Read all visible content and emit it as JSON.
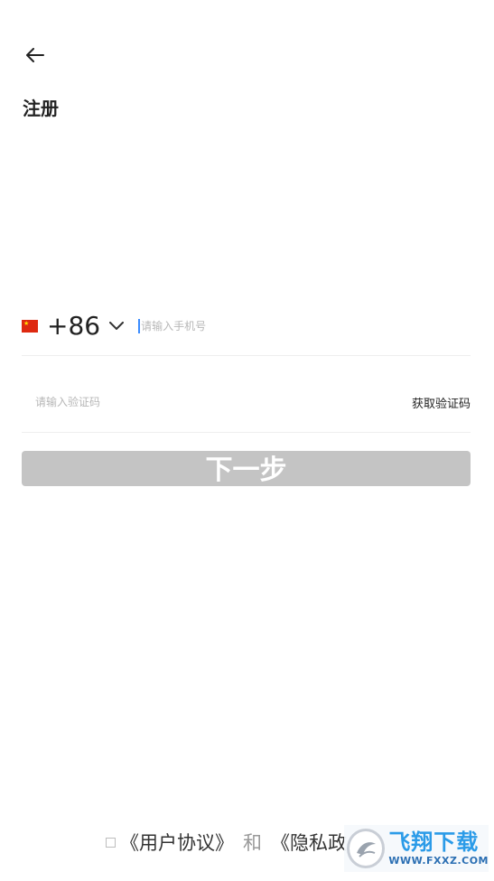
{
  "header": {
    "title": "注册"
  },
  "phone": {
    "country_code": "+86",
    "flag": "china-flag",
    "placeholder": "请输入手机号",
    "value": ""
  },
  "verification": {
    "placeholder": "请输入验证码",
    "value": "",
    "get_code_label": "获取验证码"
  },
  "next_button": {
    "label": "下一步",
    "color": "#c4c4c4",
    "enabled": false
  },
  "agreement": {
    "user_agreement": "《用户协议》",
    "and": "和",
    "privacy_policy": "《隐私政",
    "checked": false
  },
  "watermark": {
    "title": "飞翔下载",
    "url": "WWW.FXXZ.COM"
  },
  "colors": {
    "accent_cursor": "#3b8cff",
    "text": "#222222",
    "placeholder": "#b7b7b7",
    "divider": "#eeeeee",
    "watermark": "#2b9be8"
  }
}
